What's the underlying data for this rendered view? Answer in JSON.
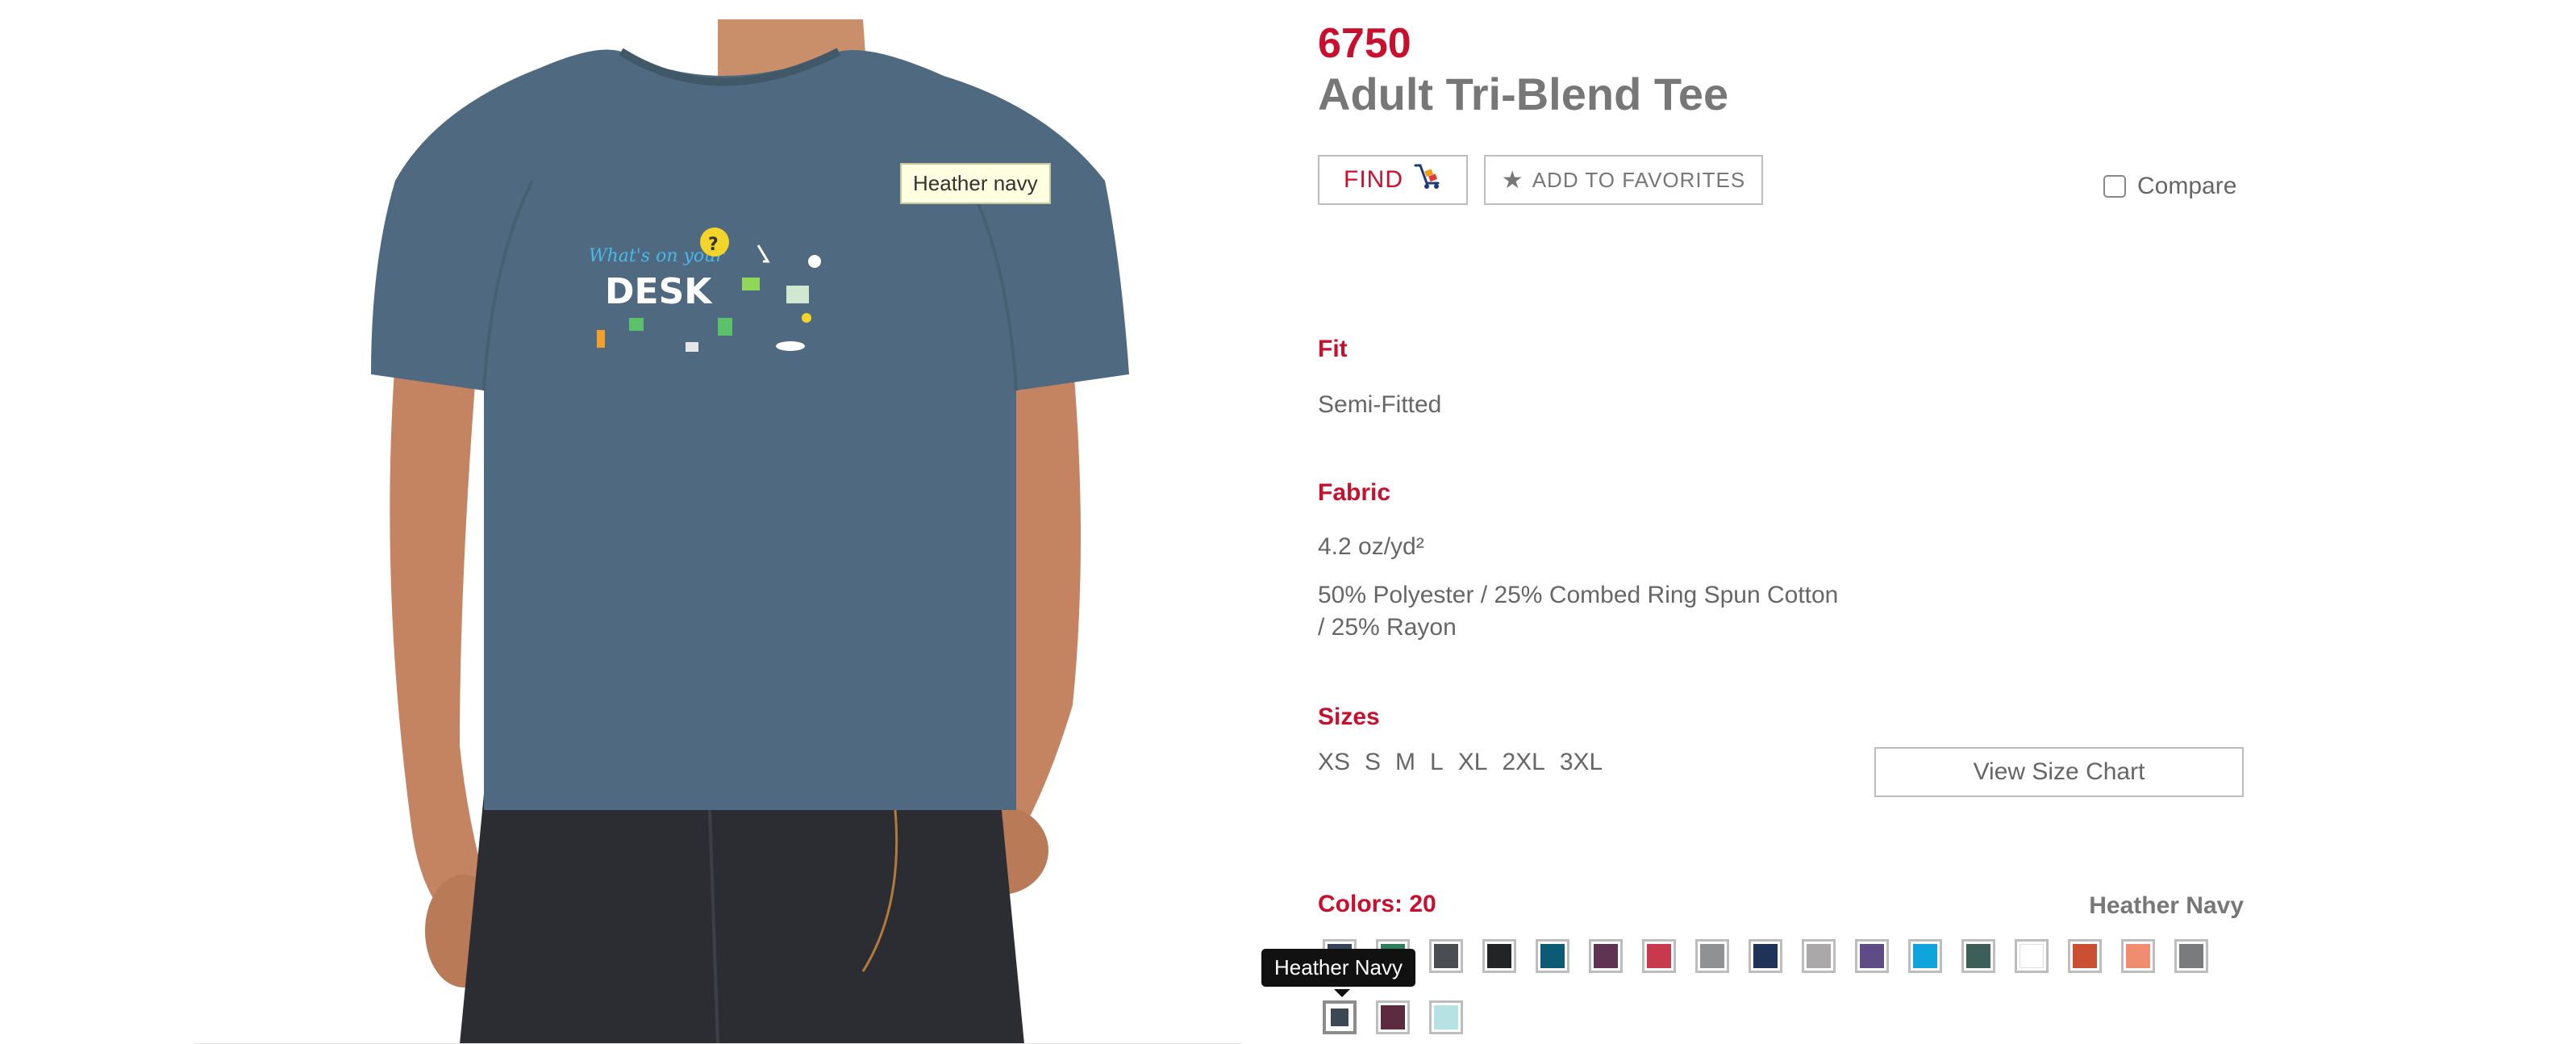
{
  "photo": {
    "hover_tooltip": "Heather navy",
    "print_script": "What's on your",
    "print_title": "DESK",
    "print_question": "?"
  },
  "product": {
    "style_number": "6750",
    "title": "Adult Tri-Blend Tee"
  },
  "actions": {
    "find_label": "FIND",
    "favorites_label": "ADD TO FAVORITES",
    "compare_label": "Compare"
  },
  "fit": {
    "label": "Fit",
    "value": "Semi-Fitted"
  },
  "fabric": {
    "label": "Fabric",
    "weight": "4.2 oz/yd²",
    "content_line1": "50% Polyester / 25% Combed Ring Spun Cotton",
    "content_line2": "/ 25% Rayon"
  },
  "sizes": {
    "label": "Sizes",
    "list": [
      "XS",
      "S",
      "M",
      "L",
      "XL",
      "2XL",
      "3XL"
    ],
    "size_chart_label": "View Size Chart"
  },
  "colors": {
    "label": "Colors: 20",
    "selected_name": "Heather Navy",
    "tooltip": "Heather Navy",
    "swatches": [
      {
        "name": "heather-navy-row1",
        "hex": "#36445a"
      },
      {
        "name": "green",
        "hex": "#2e7d5b"
      },
      {
        "name": "charcoal",
        "hex": "#4a4e52"
      },
      {
        "name": "black",
        "hex": "#222426"
      },
      {
        "name": "petrol-blue",
        "hex": "#0d5a74"
      },
      {
        "name": "plum",
        "hex": "#5e3452"
      },
      {
        "name": "red",
        "hex": "#c8394d"
      },
      {
        "name": "grey",
        "hex": "#8f9192"
      },
      {
        "name": "navy",
        "hex": "#1f3258"
      },
      {
        "name": "light-grey",
        "hex": "#aaa8a8"
      },
      {
        "name": "purple",
        "hex": "#5f4b86"
      },
      {
        "name": "sapphire",
        "hex": "#0fa5dc"
      },
      {
        "name": "emerald-grey",
        "hex": "#3e5e59"
      },
      {
        "name": "white",
        "hex": "#ffffff"
      },
      {
        "name": "orange-red",
        "hex": "#cb4f33"
      },
      {
        "name": "coral",
        "hex": "#f08d70"
      },
      {
        "name": "dark-grey",
        "hex": "#7a7b7c"
      },
      {
        "name": "heather-navy",
        "hex": "#3b4753"
      },
      {
        "name": "maroon",
        "hex": "#5c2b40"
      },
      {
        "name": "aqua",
        "hex": "#b6e2e4"
      }
    ]
  }
}
